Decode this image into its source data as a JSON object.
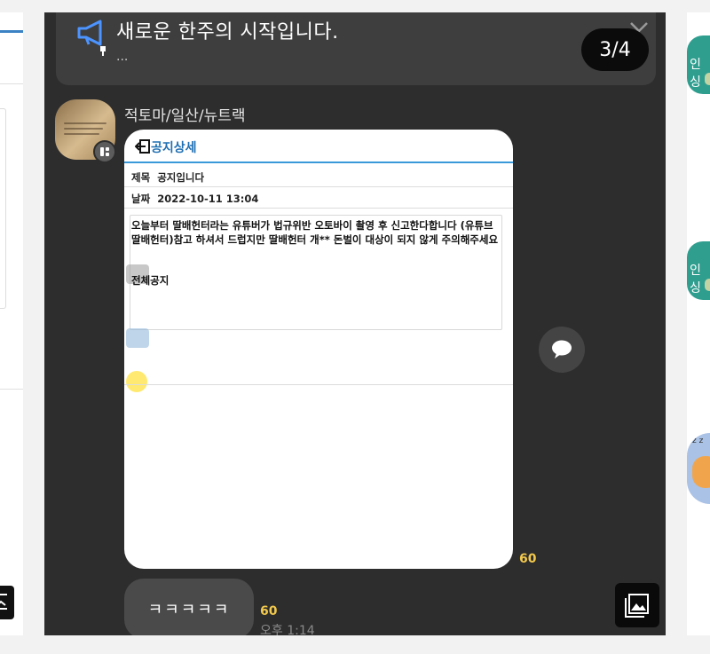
{
  "notice": {
    "title": "새로운 한주의 시작입니다.",
    "more": "...",
    "page_indicator": "3/4"
  },
  "message": {
    "sender": "적토마/일산/뉴트랙",
    "image": {
      "header": "공지상세",
      "subject_label": "제목",
      "subject": "공지입니다",
      "date_label": "날짜",
      "date": "2022-10-11 13:04",
      "body": "오늘부터 딸배헌터라는 유튜버가 법규위반 오토바이 촬영 후 신고한다합니다 (유튜브 딸배헌터)참고 하셔서 드럽지만 딸배헌터 개** 돈벌이 대상이 되지 않게 주의해주세요",
      "category": "전체공지"
    },
    "read_count": "60"
  },
  "message2": {
    "text": "ㅋㅋㅋㅋㅋ",
    "read_count": "60",
    "time": "오후 1:14"
  },
  "right_panel": {
    "label1": "인싱",
    "label2": "인싱"
  }
}
